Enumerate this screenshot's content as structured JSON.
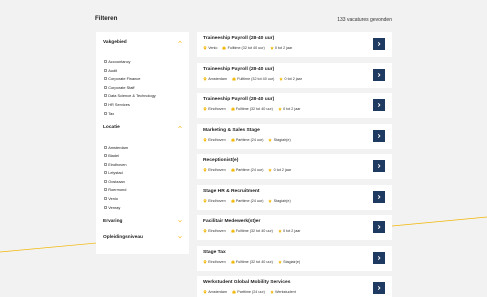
{
  "header": {
    "filters_title": "Filteren",
    "results_count": "133 vacatures gevonden"
  },
  "sidebar": {
    "sections": [
      {
        "title": "Vakgebied",
        "expanded": true,
        "options": [
          "Accountancy",
          "Audit",
          "Corporate Finance",
          "Corporate Staff",
          "Data Science & Technology",
          "HR Services",
          "Tax"
        ]
      },
      {
        "title": "Locatie",
        "expanded": true,
        "options": [
          "Amsterdam",
          "Bladel",
          "Eindhoven",
          "Lelystad",
          "Oostzaan",
          "Roermond",
          "Venlo",
          "Venray"
        ]
      },
      {
        "title": "Ervaring",
        "expanded": false,
        "options": []
      },
      {
        "title": "Opleidingsniveau",
        "expanded": false,
        "options": []
      }
    ]
  },
  "vacancies": [
    {
      "title": "Traineeship Payroll (28-40 uur)",
      "location": "Venlo",
      "hours": "Fulltime (32 tot 40 uur)",
      "experience": "0 tot 2 jaar"
    },
    {
      "title": "Traineeship Payroll (28-40 uur)",
      "location": "Amsterdam",
      "hours": "Fulltime (32 tot 40 uur)",
      "experience": "0 tot 2 jaar"
    },
    {
      "title": "Traineeship Payroll (28-40 uur)",
      "location": "Eindhoven",
      "hours": "Fulltime (32 tot 40 uur)",
      "experience": "0 tot 2 jaar"
    },
    {
      "title": "Marketing & Sales Stage",
      "location": "Eindhoven",
      "hours": "Parttime (24 uur)",
      "experience": "Stagiair(e)"
    },
    {
      "title": "Receptionist(e)",
      "location": "Eindhoven",
      "hours": "Parttime (24 uur)",
      "experience": "0 tot 2 jaar"
    },
    {
      "title": "Stage HR & Recruitment",
      "location": "Eindhoven",
      "hours": "Parttime (24 uur)",
      "experience": "Stagiair(e)"
    },
    {
      "title": "Facilitair Medewerk(st)er",
      "location": "Eindhoven",
      "hours": "Fulltime (32 tot 40 uur)",
      "experience": "0 tot 2 jaar"
    },
    {
      "title": "Stage Tax",
      "location": "Eindhoven",
      "hours": "Fulltime (32 tot 40 uur)",
      "experience": "Stagiair(e)"
    },
    {
      "title": "Werkstudent Global Mobility Services",
      "location": "Amsterdam",
      "hours": "Parttime (24 uur)",
      "experience": "Werkstudent"
    }
  ],
  "icons": {
    "location": "map-pin-icon",
    "hours": "briefcase-icon",
    "experience": "star-icon",
    "arrow": "chevron-right-icon",
    "toggle": "chevron-icon"
  },
  "colors": {
    "accent": "#f2b705",
    "button": "#1f3a60",
    "background": "#f2f2f2",
    "card": "#ffffff"
  }
}
